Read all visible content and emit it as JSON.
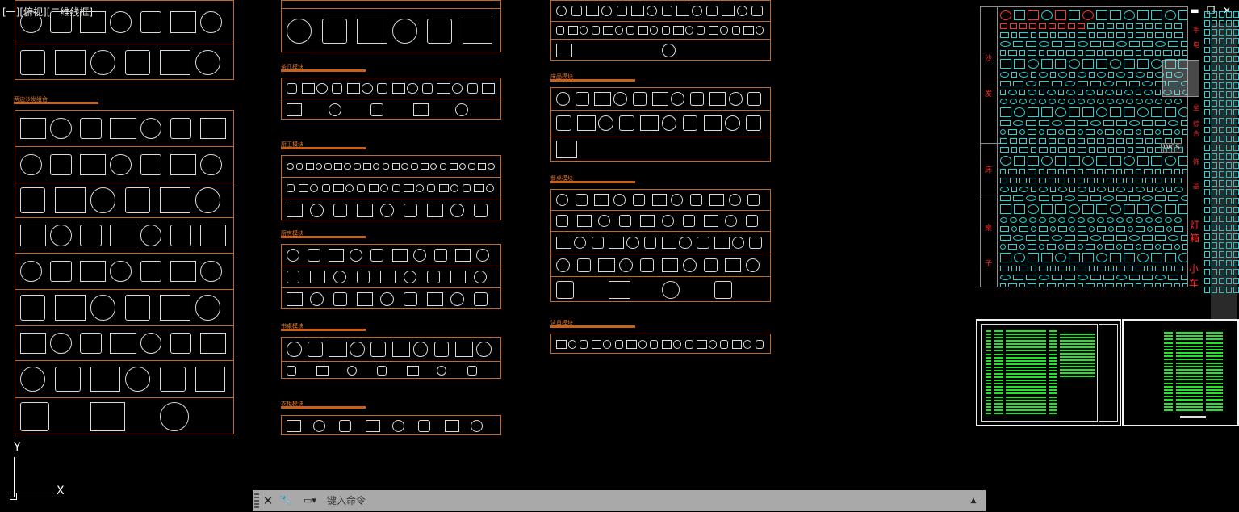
{
  "viewport": {
    "label": "[一][俯视][二维线框]",
    "controls": {
      "minimize": "▬",
      "restore": "❐",
      "close": "✕"
    }
  },
  "ucs": {
    "y": "Y",
    "x": "X"
  },
  "blocks": [
    {
      "title": "两边沙发组合"
    },
    {
      "title": "茶几模块"
    },
    {
      "title": "厨卫模块"
    },
    {
      "title": "厨房模块"
    },
    {
      "title": "书桌模块"
    },
    {
      "title": "衣柜模块"
    },
    {
      "title": "床品模块"
    },
    {
      "title": "餐桌模块"
    },
    {
      "title": "洁具模块"
    }
  ],
  "library": {
    "left_labels": [
      "沙",
      "发",
      "床",
      "桌",
      "子"
    ],
    "right_labels": [
      "灯",
      "箱",
      "小",
      "车"
    ],
    "small_labels": [
      "手",
      "电",
      "坐",
      "综",
      "合",
      "饰",
      "品"
    ]
  },
  "nav": {
    "wcs": "WCS"
  },
  "command": {
    "close_icon": "✕",
    "settings_icon": "🔧",
    "history_icon": "▭▾",
    "placeholder": "键入命令",
    "expand_icon": "▲"
  },
  "colors": {
    "background": "#000000",
    "frame": "#c06a2a",
    "block_title": "#e07830",
    "symbol": "#d9d9d9",
    "library_symbol": "#21d6d6",
    "library_label": "#ff2a2a",
    "table_green": "#22e52a"
  }
}
